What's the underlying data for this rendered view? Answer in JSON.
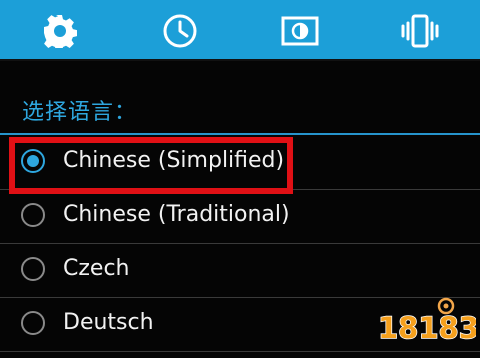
{
  "toolbar": {
    "buttons": [
      {
        "icon": "gear-icon"
      },
      {
        "icon": "clock-icon"
      },
      {
        "icon": "brightness-icon"
      },
      {
        "icon": "vibrate-icon"
      }
    ]
  },
  "dialog": {
    "title": "选择语言：",
    "options": [
      {
        "label": "Chinese (Simplified)",
        "selected": true
      },
      {
        "label": "Chinese (Traditional)",
        "selected": false
      },
      {
        "label": "Czech",
        "selected": false
      },
      {
        "label": "Deutsch",
        "selected": false
      }
    ]
  },
  "colors": {
    "toolbar_bg": "#1c9fd8",
    "accent": "#2ea7df",
    "highlight": "#e01015",
    "background": "#050505"
  },
  "watermark": {
    "text": "18183"
  }
}
